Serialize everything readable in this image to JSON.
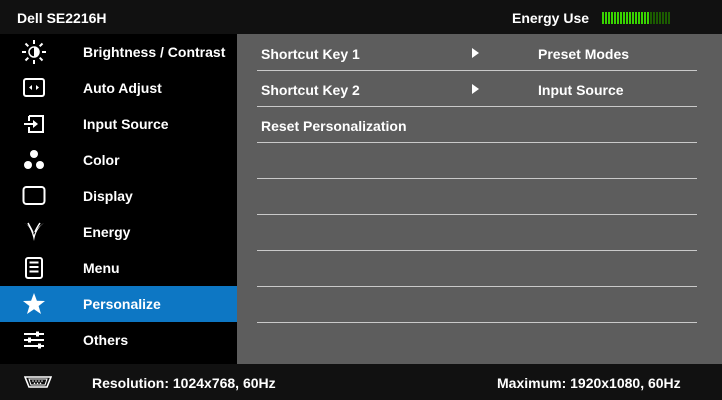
{
  "header": {
    "model": "Dell SE2216H",
    "energy_label": "Energy Use",
    "energy_meter": {
      "filled_segments": 16,
      "total_segments": 23,
      "fill_color": "#39d400",
      "empty_color": "#1c5c00"
    }
  },
  "sidebar": {
    "items": [
      {
        "label": "Brightness / Contrast",
        "icon": "brightness-icon"
      },
      {
        "label": "Auto Adjust",
        "icon": "auto-adjust-icon"
      },
      {
        "label": "Input Source",
        "icon": "input-source-icon"
      },
      {
        "label": "Color",
        "icon": "color-icon"
      },
      {
        "label": "Display",
        "icon": "display-icon"
      },
      {
        "label": "Energy",
        "icon": "energy-icon"
      },
      {
        "label": "Menu",
        "icon": "menu-icon"
      },
      {
        "label": "Personalize",
        "icon": "star-icon",
        "active": true
      },
      {
        "label": "Others",
        "icon": "others-icon"
      }
    ],
    "active_color": "#0d77c4"
  },
  "content": {
    "rows": [
      {
        "name": "Shortcut Key 1",
        "has_arrow": true,
        "value": "Preset Modes"
      },
      {
        "name": "Shortcut Key 2",
        "has_arrow": true,
        "value": "Input Source"
      },
      {
        "name": "Reset Personalization",
        "has_arrow": false,
        "value": ""
      },
      {
        "name": "",
        "has_arrow": false,
        "value": ""
      },
      {
        "name": "",
        "has_arrow": false,
        "value": ""
      },
      {
        "name": "",
        "has_arrow": false,
        "value": ""
      },
      {
        "name": "",
        "has_arrow": false,
        "value": ""
      },
      {
        "name": "",
        "has_arrow": false,
        "value": ""
      }
    ],
    "background": "#5d5d5d"
  },
  "footer": {
    "connector_icon": "vga-connector-icon",
    "resolution": "Resolution: 1024x768, 60Hz",
    "maximum": "Maximum: 1920x1080, 60Hz"
  }
}
